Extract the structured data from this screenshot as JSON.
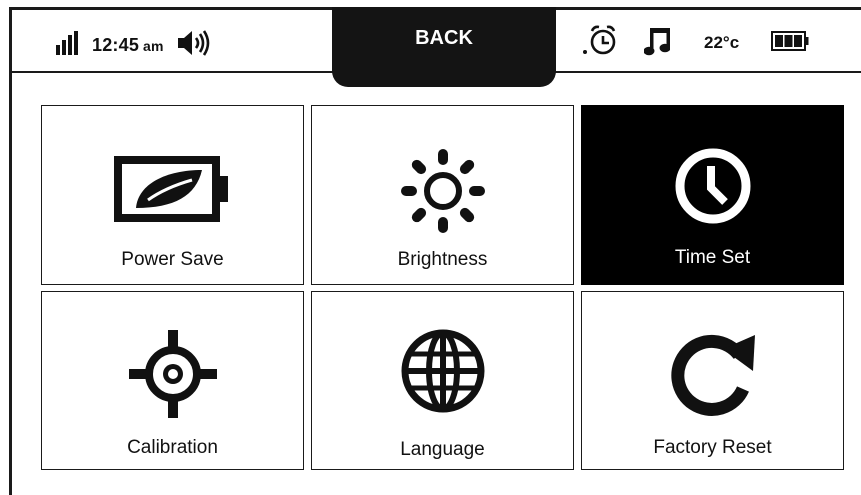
{
  "status_bar": {
    "time": "12:45",
    "time_suffix": "am",
    "back_label": "BACK",
    "temperature": "22°c",
    "icons": [
      "signal-icon",
      "speaker-icon",
      "alarm-icon",
      "music-icon",
      "battery-icon"
    ]
  },
  "tiles": [
    {
      "label": "Power Save",
      "icon": "power-save-icon"
    },
    {
      "label": "Brightness",
      "icon": "brightness-icon"
    },
    {
      "label": "Time Set",
      "icon": "clock-icon",
      "selected": true
    },
    {
      "label": "Calibration",
      "icon": "crosshair-icon"
    },
    {
      "label": "Language",
      "icon": "globe-icon"
    },
    {
      "label": "Factory Reset",
      "icon": "reset-icon"
    }
  ],
  "colors": {
    "foreground": "#111111",
    "background": "#ffffff",
    "selected_tile": "#000000"
  }
}
